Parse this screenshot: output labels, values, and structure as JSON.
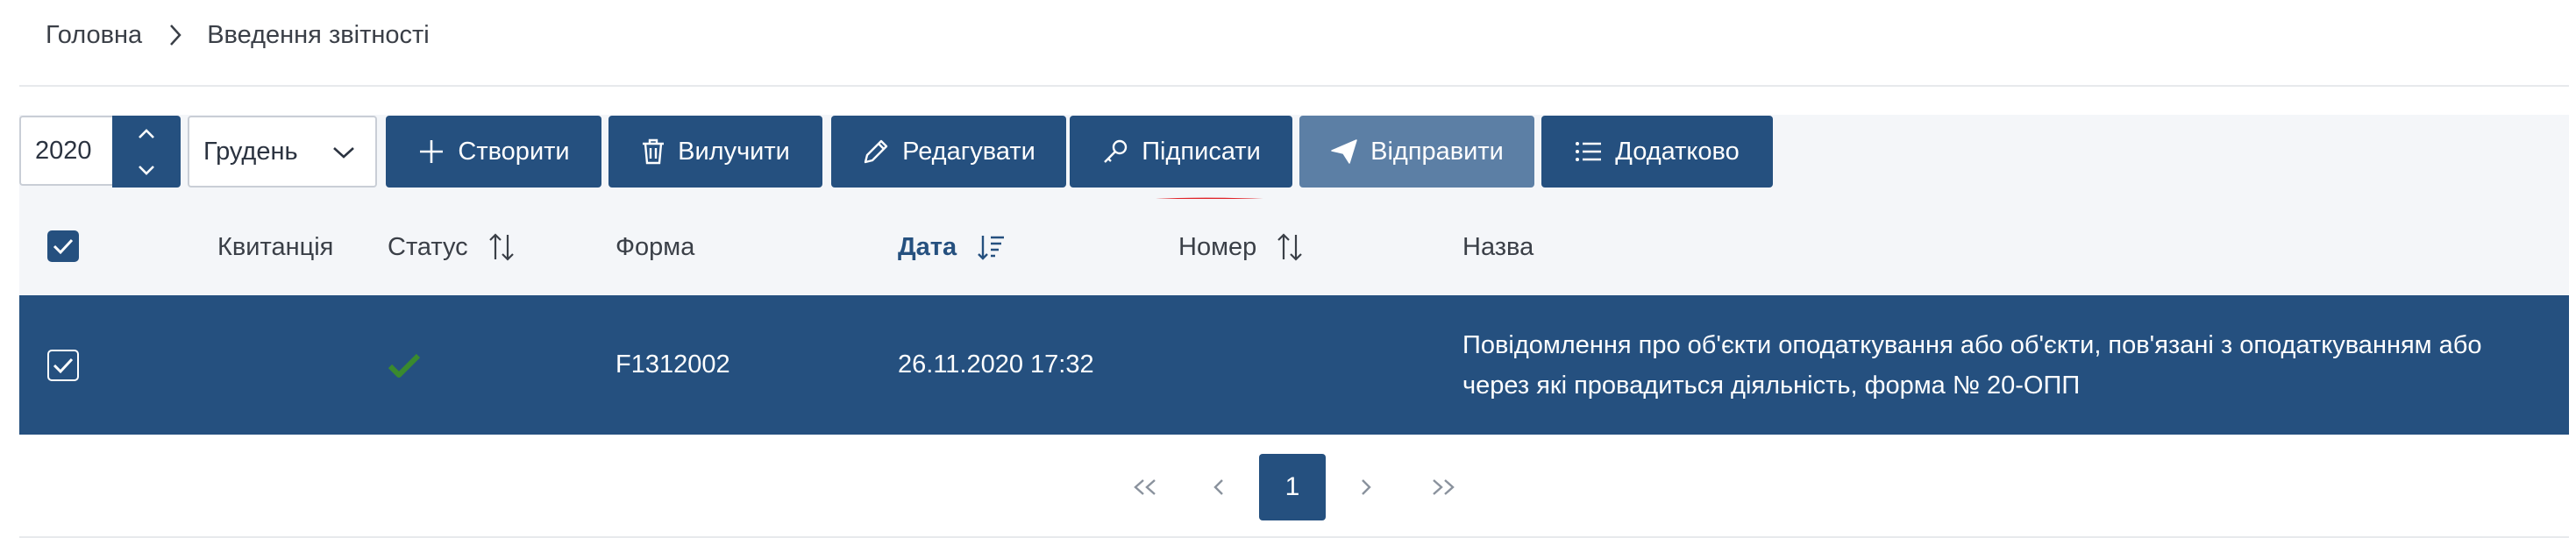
{
  "breadcrumb": {
    "home": "Головна",
    "current": "Введення звітності"
  },
  "toolbar": {
    "year": "2020",
    "month": "Грудень",
    "buttons": {
      "create": "Створити",
      "delete": "Вилучити",
      "edit": "Редагувати",
      "sign": "Підписати",
      "send": "Відправити",
      "more": "Додатково"
    }
  },
  "table": {
    "columns": {
      "receipt": "Квитанція",
      "status": "Статус",
      "form": "Форма",
      "date": "Дата",
      "number": "Номер",
      "name": "Назва"
    },
    "rows": [
      {
        "receipt": "",
        "status": "ok",
        "form": "F1312002",
        "date": "26.11.2020 17:32",
        "number": "",
        "name_line1": "Повідомлення про об'єкти оподаткування або об'єкти, пов'язані з оподаткуванням або",
        "name_line2": "через які провадиться діяльність, форма № 20-ОПП"
      }
    ]
  },
  "pagination": {
    "current_page": "1"
  },
  "colors": {
    "primary": "#25507f",
    "disabled": "#5c7fa5",
    "check": "#3a8a2e",
    "annotation": "#e0242a"
  }
}
